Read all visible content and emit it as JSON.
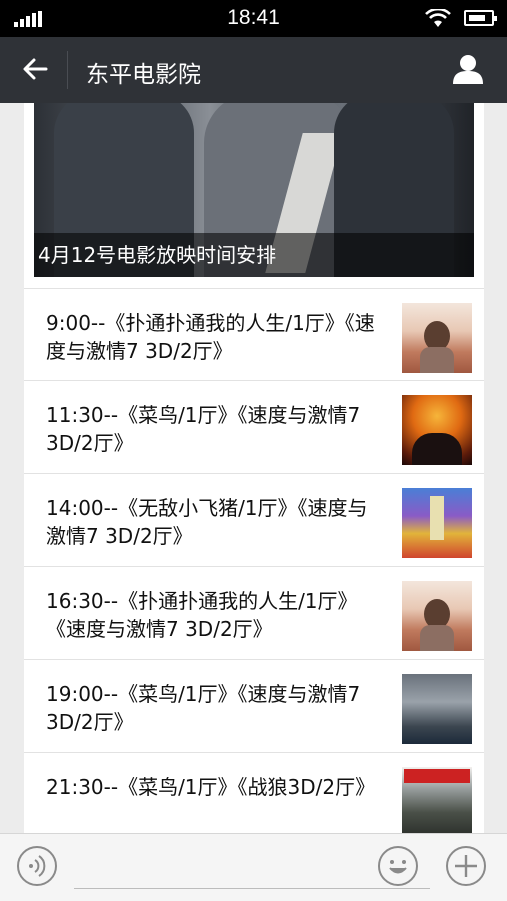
{
  "status_bar": {
    "time": "18:41"
  },
  "nav": {
    "title": "东平电影院"
  },
  "banner": {
    "caption": "4月12号电影放映时间安排"
  },
  "schedule": [
    {
      "text": "9:00--《扑通扑通我的人生/1厅》《速度与激情7 3D/2厅》"
    },
    {
      "text": "11:30--《菜鸟/1厅》《速度与激情7 3D/2厅》"
    },
    {
      "text": "14:00--《无敌小飞猪/1厅》《速度与激情7 3D/2厅》"
    },
    {
      "text": "16:30--《扑通扑通我的人生/1厅》《速度与激情7 3D/2厅》"
    },
    {
      "text": "19:00--《菜鸟/1厅》《速度与激情7 3D/2厅》"
    },
    {
      "text": "21:30--《菜鸟/1厅》《战狼3D/2厅》"
    }
  ],
  "icons": {
    "back": "arrow-left-icon",
    "profile": "user-icon",
    "voice": "voice-icon",
    "emoji": "emoji-icon",
    "add": "plus-icon"
  },
  "colors": {
    "nav_bg": "#2f3237",
    "status_bg": "#000000",
    "page_bg": "#ececec"
  }
}
